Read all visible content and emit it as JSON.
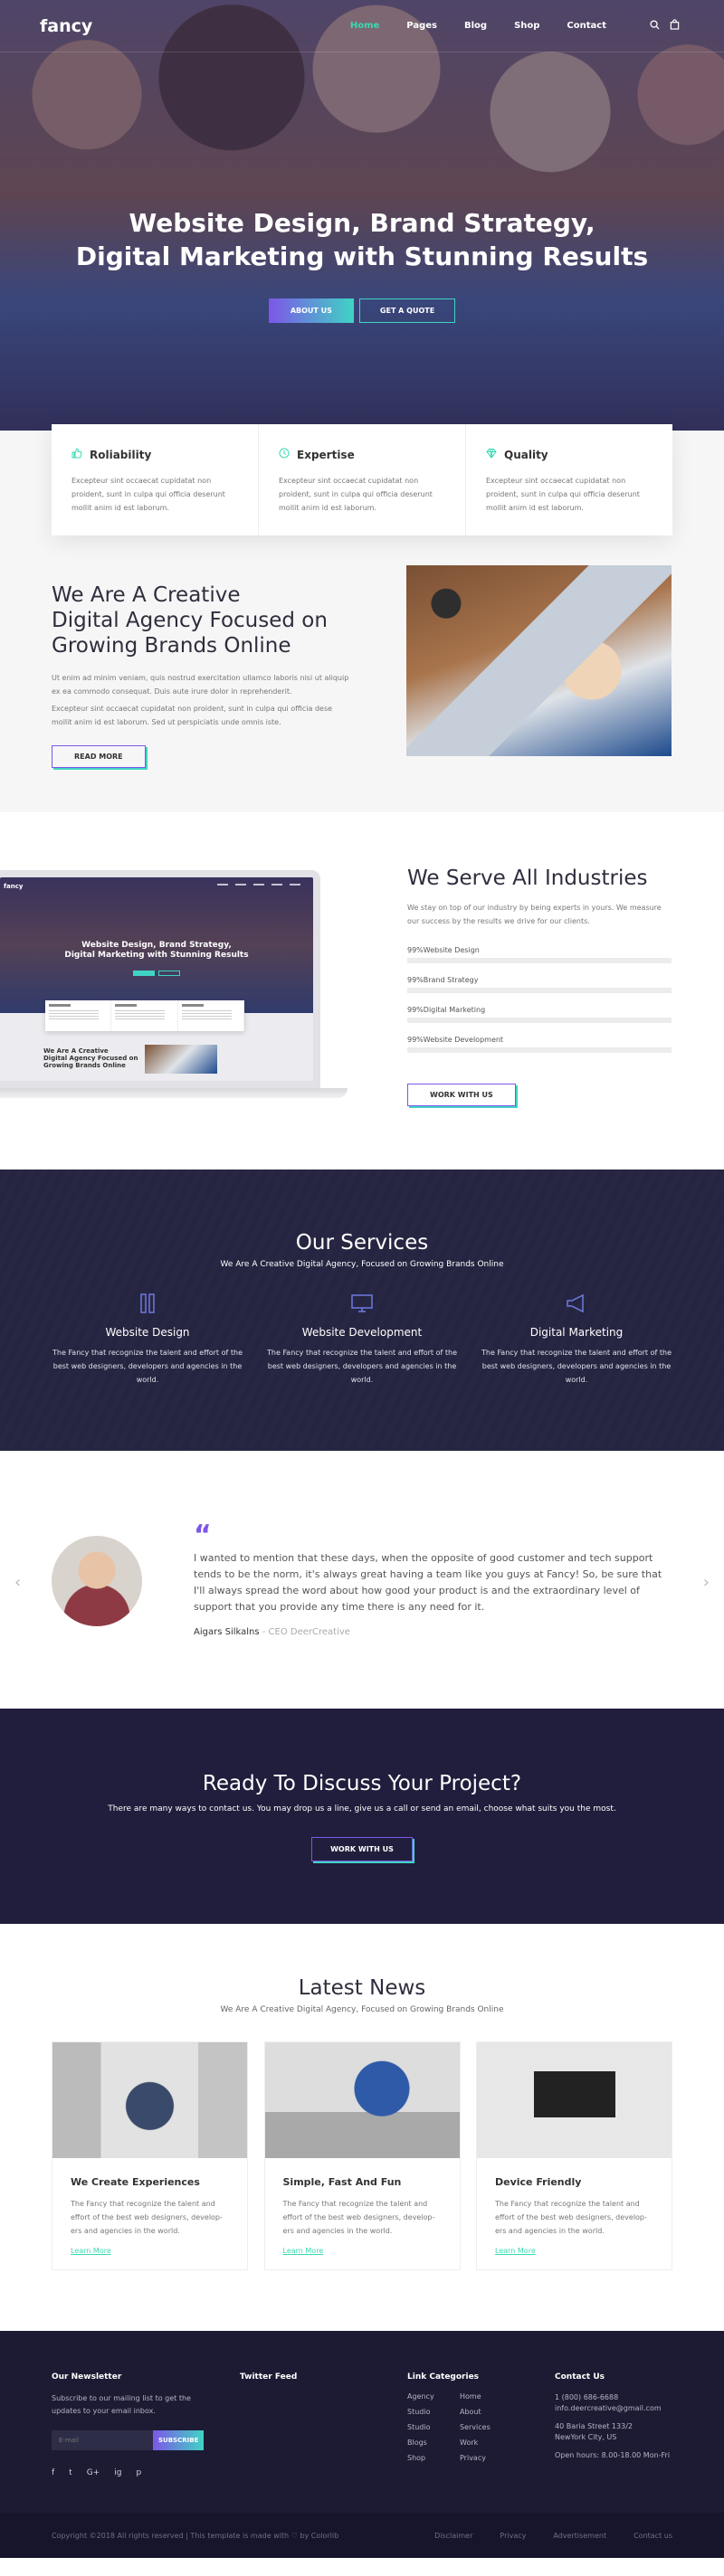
{
  "nav": {
    "logo": "fancy",
    "links": [
      "Home",
      "Pages",
      "Blog",
      "Shop",
      "Contact"
    ],
    "active": "Home",
    "icons": [
      "search-icon",
      "bag-icon"
    ]
  },
  "hero": {
    "title_line1": "Website Design, Brand Strategy,",
    "title_line2": "Digital Marketing with Stunning Results",
    "btn_primary": "ABOUT US",
    "btn_secondary": "GET A QUOTE"
  },
  "features": [
    {
      "icon": "thumbs-up-icon",
      "title": "Roliability",
      "text": "Excepteur sint occaecat cupidatat non proident, sunt in culpa qui officia deserunt mollit anim id est laborum."
    },
    {
      "icon": "clock-icon",
      "title": "Expertise",
      "text": "Excepteur sint occaecat cupidatat non proident, sunt in culpa qui officia deserunt mollit anim id est laborum."
    },
    {
      "icon": "diamond-icon",
      "title": "Quality",
      "text": "Excepteur sint occaecat cupidatat non proident, sunt in culpa qui officia deserunt mollit anim id est laborum."
    }
  ],
  "about": {
    "title_l1": "We Are A Creative",
    "title_l2": "Digital Agency Focused on",
    "title_l3": "Growing Brands Online",
    "p1": "Ut enim ad minim veniam, quis nostrud exercitation ullamco laboris nisi ut aliquip ex ea commodo consequat. Duis aute irure dolor in reprehenderit.",
    "p2": "Excepteur sint occaecat cupidatat non proident, sunt in culpa qui officia dese mollit anim id est laborum. Sed ut perspiciatis unde omnis iste.",
    "button": "READ MORE"
  },
  "industries": {
    "title": "We Serve All Industries",
    "text": "We stay on top of our industry by being experts in yours. We measure our success by the results we drive for our clients.",
    "skills": [
      {
        "percent": 99,
        "prefix": "99%",
        "label": "Website Design"
      },
      {
        "percent": 99,
        "prefix": "99%",
        "label": "Brand Strategy"
      },
      {
        "percent": 99,
        "prefix": "99%",
        "label": "Digital Marketing"
      },
      {
        "percent": 99,
        "prefix": "99%",
        "label": "Website Development"
      }
    ],
    "button": "WORK WITH US",
    "mini": {
      "logo": "fancy",
      "title_l1": "Website Design, Brand Strategy,",
      "title_l2": "Digital Marketing with Stunning Results",
      "about_l1": "We Are A Creative",
      "about_l2": "Digital Agency Focused on",
      "about_l3": "Growing Brands Online"
    }
  },
  "services": {
    "title": "Our Services",
    "subtitle": "We Are A Creative Digital Agency, Focused on Growing Brands Online",
    "items": [
      {
        "icon": "pencils-icon",
        "name": "Website Design",
        "text": "The Fancy that recognize the talent and effort of the best web designers, developers and agencies in the world."
      },
      {
        "icon": "monitor-icon",
        "name": "Website Development",
        "text": "The Fancy that recognize the talent and effort of the best web designers, developers and agencies in the world."
      },
      {
        "icon": "megaphone-icon",
        "name": "Digital Marketing",
        "text": "The Fancy that recognize the talent and effort of the best web designers, developers and agencies in the world."
      }
    ]
  },
  "testimonial": {
    "quote_glyph": "“",
    "text": "I wanted to mention that these days, when the opposite of good customer and tech support tends to be the norm, it's always great having a team like you guys at Fancy! So, be sure that I'll always spread the word about how good your product is and the extraordinary level of support that you provide any time there is any need for it.",
    "author": "Aigars Silkalns",
    "role": " - CEO DeerCreative",
    "prev": "‹",
    "next": "›"
  },
  "cta": {
    "title": "Ready To Discuss Your Project?",
    "text": "There are many ways to contact us. You may drop us a line, give us a call or send an email, choose what suits you the most.",
    "button": "WORK WITH US"
  },
  "news": {
    "title": "Latest News",
    "subtitle": "We Are A Creative Digital Agency, Focused on Growing Brands Online",
    "items": [
      {
        "title": "We Create Experiences",
        "text": "The Fancy that recognize the talent and effort of the best web designers, develop-ers and agencies in the world.",
        "link": "Learn More"
      },
      {
        "title": "Simple, Fast And Fun",
        "text": "The Fancy that recognize the talent and effort of the best web designers, develop-ers and agencies in the world.",
        "link": "Learn More"
      },
      {
        "title": "Device Friendly",
        "text": "The Fancy that recognize the talent and effort of the best web designers, develop-ers and agencies in the world.",
        "link": "Learn More"
      }
    ]
  },
  "footer": {
    "newsletter": {
      "heading": "Our Newsletter",
      "text": "Subscribe to our mailing list to get the updates to your email inbox.",
      "placeholder": "E-mail",
      "button": "SUBSCRIBE",
      "socials": [
        "f",
        "t",
        "G+",
        "ig",
        "p"
      ]
    },
    "twitter": {
      "heading": "Twitter Feed"
    },
    "links": {
      "heading": "Link Categories",
      "items": [
        "Agency",
        "Home",
        "Studio",
        "About",
        "Studio",
        "Services",
        "Blogs",
        "Work",
        "Shop",
        "Privacy"
      ]
    },
    "contact": {
      "heading": "Contact Us",
      "phone": "1 (800) 686-6688",
      "email": "info.deercreative@gmail.com",
      "addr1": "40 Baria Street 133/2",
      "addr2": "NewYork City, US",
      "hours": "Open hours: 8.00-18.00 Mon-Fri"
    },
    "copyright": "Copyright ©2018 All rights reserved | This template is made with ♡ by Colorlib",
    "bottom_links": [
      "Disclaimer",
      "Privacy",
      "Advertisement",
      "Contact us"
    ]
  },
  "colors": {
    "accent_teal": "#3ad9b3",
    "accent_purple": "#7d56e8",
    "dark": "#201e3c"
  }
}
